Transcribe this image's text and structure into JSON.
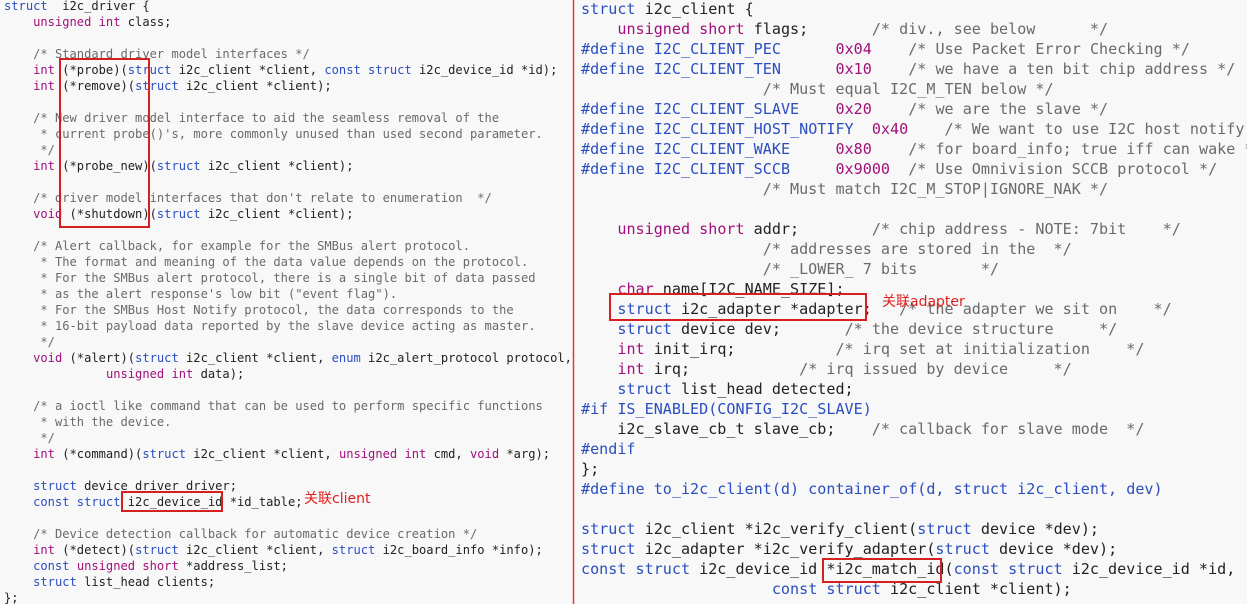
{
  "left_panel": {
    "lines": [
      [
        [
          "kw",
          "struct"
        ],
        [
          "",
          "  i2c_driver {"
        ]
      ],
      [
        [
          "",
          "    "
        ],
        [
          "ty",
          "unsigned int"
        ],
        [
          "",
          " class;"
        ]
      ],
      [
        [
          "",
          ""
        ]
      ],
      [
        [
          "",
          "    "
        ],
        [
          "cm",
          "/* Standard driver model interfaces */"
        ]
      ],
      [
        [
          "",
          "    "
        ],
        [
          "ty",
          "int"
        ],
        [
          "",
          " (*probe)("
        ],
        [
          "kw",
          "struct"
        ],
        [
          "",
          " i2c_client *client, "
        ],
        [
          "kw",
          "const struct"
        ],
        [
          "",
          " i2c_device_id *id);"
        ]
      ],
      [
        [
          "",
          "    "
        ],
        [
          "ty",
          "int"
        ],
        [
          "",
          " (*remove)("
        ],
        [
          "kw",
          "struct"
        ],
        [
          "",
          " i2c_client *client);"
        ]
      ],
      [
        [
          "",
          ""
        ]
      ],
      [
        [
          "",
          "    "
        ],
        [
          "cm",
          "/* New driver model interface to aid the seamless removal of the"
        ]
      ],
      [
        [
          "",
          "     "
        ],
        [
          "cm",
          "* current probe()'s, more commonly unused than used second parameter."
        ]
      ],
      [
        [
          "",
          "     "
        ],
        [
          "cm",
          "*/"
        ]
      ],
      [
        [
          "",
          "    "
        ],
        [
          "ty",
          "int"
        ],
        [
          "",
          " (*probe_new)("
        ],
        [
          "kw",
          "struct"
        ],
        [
          "",
          " i2c_client *client);"
        ]
      ],
      [
        [
          "",
          ""
        ]
      ],
      [
        [
          "",
          "    "
        ],
        [
          "cm",
          "/* driver model interfaces that don't relate to enumeration  */"
        ]
      ],
      [
        [
          "",
          "    "
        ],
        [
          "ty",
          "void"
        ],
        [
          "",
          " (*shutdown)("
        ],
        [
          "kw",
          "struct"
        ],
        [
          "",
          " i2c_client *client);"
        ]
      ],
      [
        [
          "",
          ""
        ]
      ],
      [
        [
          "",
          "    "
        ],
        [
          "cm",
          "/* Alert callback, for example for the SMBus alert protocol."
        ]
      ],
      [
        [
          "",
          "     "
        ],
        [
          "cm",
          "* The format and meaning of the data value depends on the protocol."
        ]
      ],
      [
        [
          "",
          "     "
        ],
        [
          "cm",
          "* For the SMBus alert protocol, there is a single bit of data passed"
        ]
      ],
      [
        [
          "",
          "     "
        ],
        [
          "cm",
          "* as the alert response's low bit (\"event flag\")."
        ]
      ],
      [
        [
          "",
          "     "
        ],
        [
          "cm",
          "* For the SMBus Host Notify protocol, the data corresponds to the"
        ]
      ],
      [
        [
          "",
          "     "
        ],
        [
          "cm",
          "* 16-bit payload data reported by the slave device acting as master."
        ]
      ],
      [
        [
          "",
          "     "
        ],
        [
          "cm",
          "*/"
        ]
      ],
      [
        [
          "",
          "    "
        ],
        [
          "ty",
          "void"
        ],
        [
          "",
          " (*alert)("
        ],
        [
          "kw",
          "struct"
        ],
        [
          "",
          " i2c_client *client, "
        ],
        [
          "kw",
          "enum"
        ],
        [
          "",
          " i2c_alert_protocol protocol,"
        ]
      ],
      [
        [
          "",
          "              "
        ],
        [
          "ty",
          "unsigned int"
        ],
        [
          "",
          " data);"
        ]
      ],
      [
        [
          "",
          ""
        ]
      ],
      [
        [
          "",
          "    "
        ],
        [
          "cm",
          "/* a ioctl like command that can be used to perform specific functions"
        ]
      ],
      [
        [
          "",
          "     "
        ],
        [
          "cm",
          "* with the device."
        ]
      ],
      [
        [
          "",
          "     "
        ],
        [
          "cm",
          "*/"
        ]
      ],
      [
        [
          "",
          "    "
        ],
        [
          "ty",
          "int"
        ],
        [
          "",
          " (*command)("
        ],
        [
          "kw",
          "struct"
        ],
        [
          "",
          " i2c_client *client, "
        ],
        [
          "ty",
          "unsigned int"
        ],
        [
          "",
          " cmd, "
        ],
        [
          "ty",
          "void"
        ],
        [
          "",
          " *arg);"
        ]
      ],
      [
        [
          "",
          ""
        ]
      ],
      [
        [
          "",
          "    "
        ],
        [
          "kw",
          "struct"
        ],
        [
          "",
          " device_driver driver;"
        ]
      ],
      [
        [
          "",
          "    "
        ],
        [
          "kw",
          "const struct"
        ],
        [
          "",
          " i2c_device_id *id_table;"
        ]
      ],
      [
        [
          "",
          ""
        ]
      ],
      [
        [
          "",
          "    "
        ],
        [
          "cm",
          "/* Device detection callback for automatic device creation */"
        ]
      ],
      [
        [
          "",
          "    "
        ],
        [
          "ty",
          "int"
        ],
        [
          "",
          " (*detect)("
        ],
        [
          "kw",
          "struct"
        ],
        [
          "",
          " i2c_client *client, "
        ],
        [
          "kw",
          "struct"
        ],
        [
          "",
          " i2c_board_info *info);"
        ]
      ],
      [
        [
          "",
          "    "
        ],
        [
          "kw",
          "const"
        ],
        [
          "",
          " "
        ],
        [
          "ty",
          "unsigned short"
        ],
        [
          "",
          " *address_list;"
        ]
      ],
      [
        [
          "",
          "    "
        ],
        [
          "kw",
          "struct"
        ],
        [
          "",
          " list_head clients;"
        ]
      ],
      [
        [
          "",
          "};"
        ]
      ]
    ],
    "annotation": "关联client"
  },
  "right_panel": {
    "lines": [
      [
        [
          "kw",
          "struct"
        ],
        [
          "",
          " i2c_client {"
        ]
      ],
      [
        [
          "",
          "    "
        ],
        [
          "ty",
          "unsigned short"
        ],
        [
          "",
          " flags;       "
        ],
        [
          "cm",
          "/* div., see below      */"
        ]
      ],
      [
        [
          "pp",
          "#define"
        ],
        [
          "",
          " "
        ],
        [
          "pp",
          "I2C_CLIENT_PEC"
        ],
        [
          "",
          "      "
        ],
        [
          "ty",
          "0x04"
        ],
        [
          "",
          "    "
        ],
        [
          "cm",
          "/* Use Packet Error Checking */"
        ]
      ],
      [
        [
          "pp",
          "#define"
        ],
        [
          "",
          " "
        ],
        [
          "pp",
          "I2C_CLIENT_TEN"
        ],
        [
          "",
          "      "
        ],
        [
          "ty",
          "0x10"
        ],
        [
          "",
          "    "
        ],
        [
          "cm",
          "/* we have a ten bit chip address */"
        ]
      ],
      [
        [
          "",
          "                    "
        ],
        [
          "cm",
          "/* Must equal I2C_M_TEN below */"
        ]
      ],
      [
        [
          "pp",
          "#define"
        ],
        [
          "",
          " "
        ],
        [
          "pp",
          "I2C_CLIENT_SLAVE"
        ],
        [
          "",
          "    "
        ],
        [
          "ty",
          "0x20"
        ],
        [
          "",
          "    "
        ],
        [
          "cm",
          "/* we are the slave */"
        ]
      ],
      [
        [
          "pp",
          "#define"
        ],
        [
          "",
          " "
        ],
        [
          "pp",
          "I2C_CLIENT_HOST_NOTIFY"
        ],
        [
          "",
          "  "
        ],
        [
          "ty",
          "0x40"
        ],
        [
          "",
          "    "
        ],
        [
          "cm",
          "/* We want to use I2C host notify */"
        ]
      ],
      [
        [
          "pp",
          "#define"
        ],
        [
          "",
          " "
        ],
        [
          "pp",
          "I2C_CLIENT_WAKE"
        ],
        [
          "",
          "     "
        ],
        [
          "ty",
          "0x80"
        ],
        [
          "",
          "    "
        ],
        [
          "cm",
          "/* for board_info; true iff can wake */"
        ]
      ],
      [
        [
          "pp",
          "#define"
        ],
        [
          "",
          " "
        ],
        [
          "pp",
          "I2C_CLIENT_SCCB"
        ],
        [
          "",
          "     "
        ],
        [
          "ty",
          "0x9000"
        ],
        [
          "",
          "  "
        ],
        [
          "cm",
          "/* Use Omnivision SCCB protocol */"
        ]
      ],
      [
        [
          "",
          "                    "
        ],
        [
          "cm",
          "/* Must match I2C_M_STOP|IGNORE_NAK */"
        ]
      ],
      [
        [
          "",
          ""
        ]
      ],
      [
        [
          "",
          "    "
        ],
        [
          "ty",
          "unsigned short"
        ],
        [
          "",
          " addr;        "
        ],
        [
          "cm",
          "/* chip address - NOTE: 7bit    */"
        ]
      ],
      [
        [
          "",
          "                    "
        ],
        [
          "cm",
          "/* addresses are stored in the  */"
        ]
      ],
      [
        [
          "",
          "                    "
        ],
        [
          "cm",
          "/* _LOWER_ 7 bits       */"
        ]
      ],
      [
        [
          "",
          "    "
        ],
        [
          "ty",
          "char"
        ],
        [
          "",
          " name[I2C_NAME_SIZE];"
        ]
      ],
      [
        [
          "",
          "    "
        ],
        [
          "kw",
          "struct"
        ],
        [
          "",
          " i2c_adapter *adapter;   "
        ],
        [
          "cm",
          "/* the adapter we sit on    */"
        ]
      ],
      [
        [
          "",
          "    "
        ],
        [
          "kw",
          "struct"
        ],
        [
          "",
          " device dev;       "
        ],
        [
          "cm",
          "/* the device structure     */"
        ]
      ],
      [
        [
          "",
          "    "
        ],
        [
          "ty",
          "int"
        ],
        [
          "",
          " init_irq;           "
        ],
        [
          "cm",
          "/* irq set at initialization    */"
        ]
      ],
      [
        [
          "",
          "    "
        ],
        [
          "ty",
          "int"
        ],
        [
          "",
          " irq;            "
        ],
        [
          "cm",
          "/* irq issued by device     */"
        ]
      ],
      [
        [
          "",
          "    "
        ],
        [
          "kw",
          "struct"
        ],
        [
          "",
          " list_head detected;"
        ]
      ],
      [
        [
          "pp",
          "#if IS_ENABLED(CONFIG_I2C_SLAVE)"
        ]
      ],
      [
        [
          "",
          "    i2c_slave_cb_t slave_cb;    "
        ],
        [
          "cm",
          "/* callback for slave mode  */"
        ]
      ],
      [
        [
          "pp",
          "#endif"
        ]
      ],
      [
        [
          "",
          "};"
        ]
      ],
      [
        [
          "pp",
          "#define to_i2c_client(d) container_of(d, struct i2c_client, dev)"
        ]
      ],
      [
        [
          "",
          ""
        ]
      ],
      [
        [
          "kw",
          "struct"
        ],
        [
          "",
          " i2c_client *i2c_verify_client("
        ],
        [
          "kw",
          "struct"
        ],
        [
          "",
          " device *dev);"
        ]
      ],
      [
        [
          "kw",
          "struct"
        ],
        [
          "",
          " i2c_adapter *i2c_verify_adapter("
        ],
        [
          "kw",
          "struct"
        ],
        [
          "",
          " device *dev);"
        ]
      ],
      [
        [
          "kw",
          "const struct"
        ],
        [
          "",
          " i2c_device_id *i2c_match_id("
        ],
        [
          "kw",
          "const struct"
        ],
        [
          "",
          " i2c_device_id *id,"
        ]
      ],
      [
        [
          "",
          "                     "
        ],
        [
          "kw",
          "const struct"
        ],
        [
          "",
          " i2c_client *client);"
        ]
      ]
    ],
    "annotation": "关联adapter"
  },
  "colors": {
    "keyword": "#2a4ec0",
    "type": "#a0107a",
    "comment": "#6a6a6a",
    "highlight": "#d42020"
  }
}
